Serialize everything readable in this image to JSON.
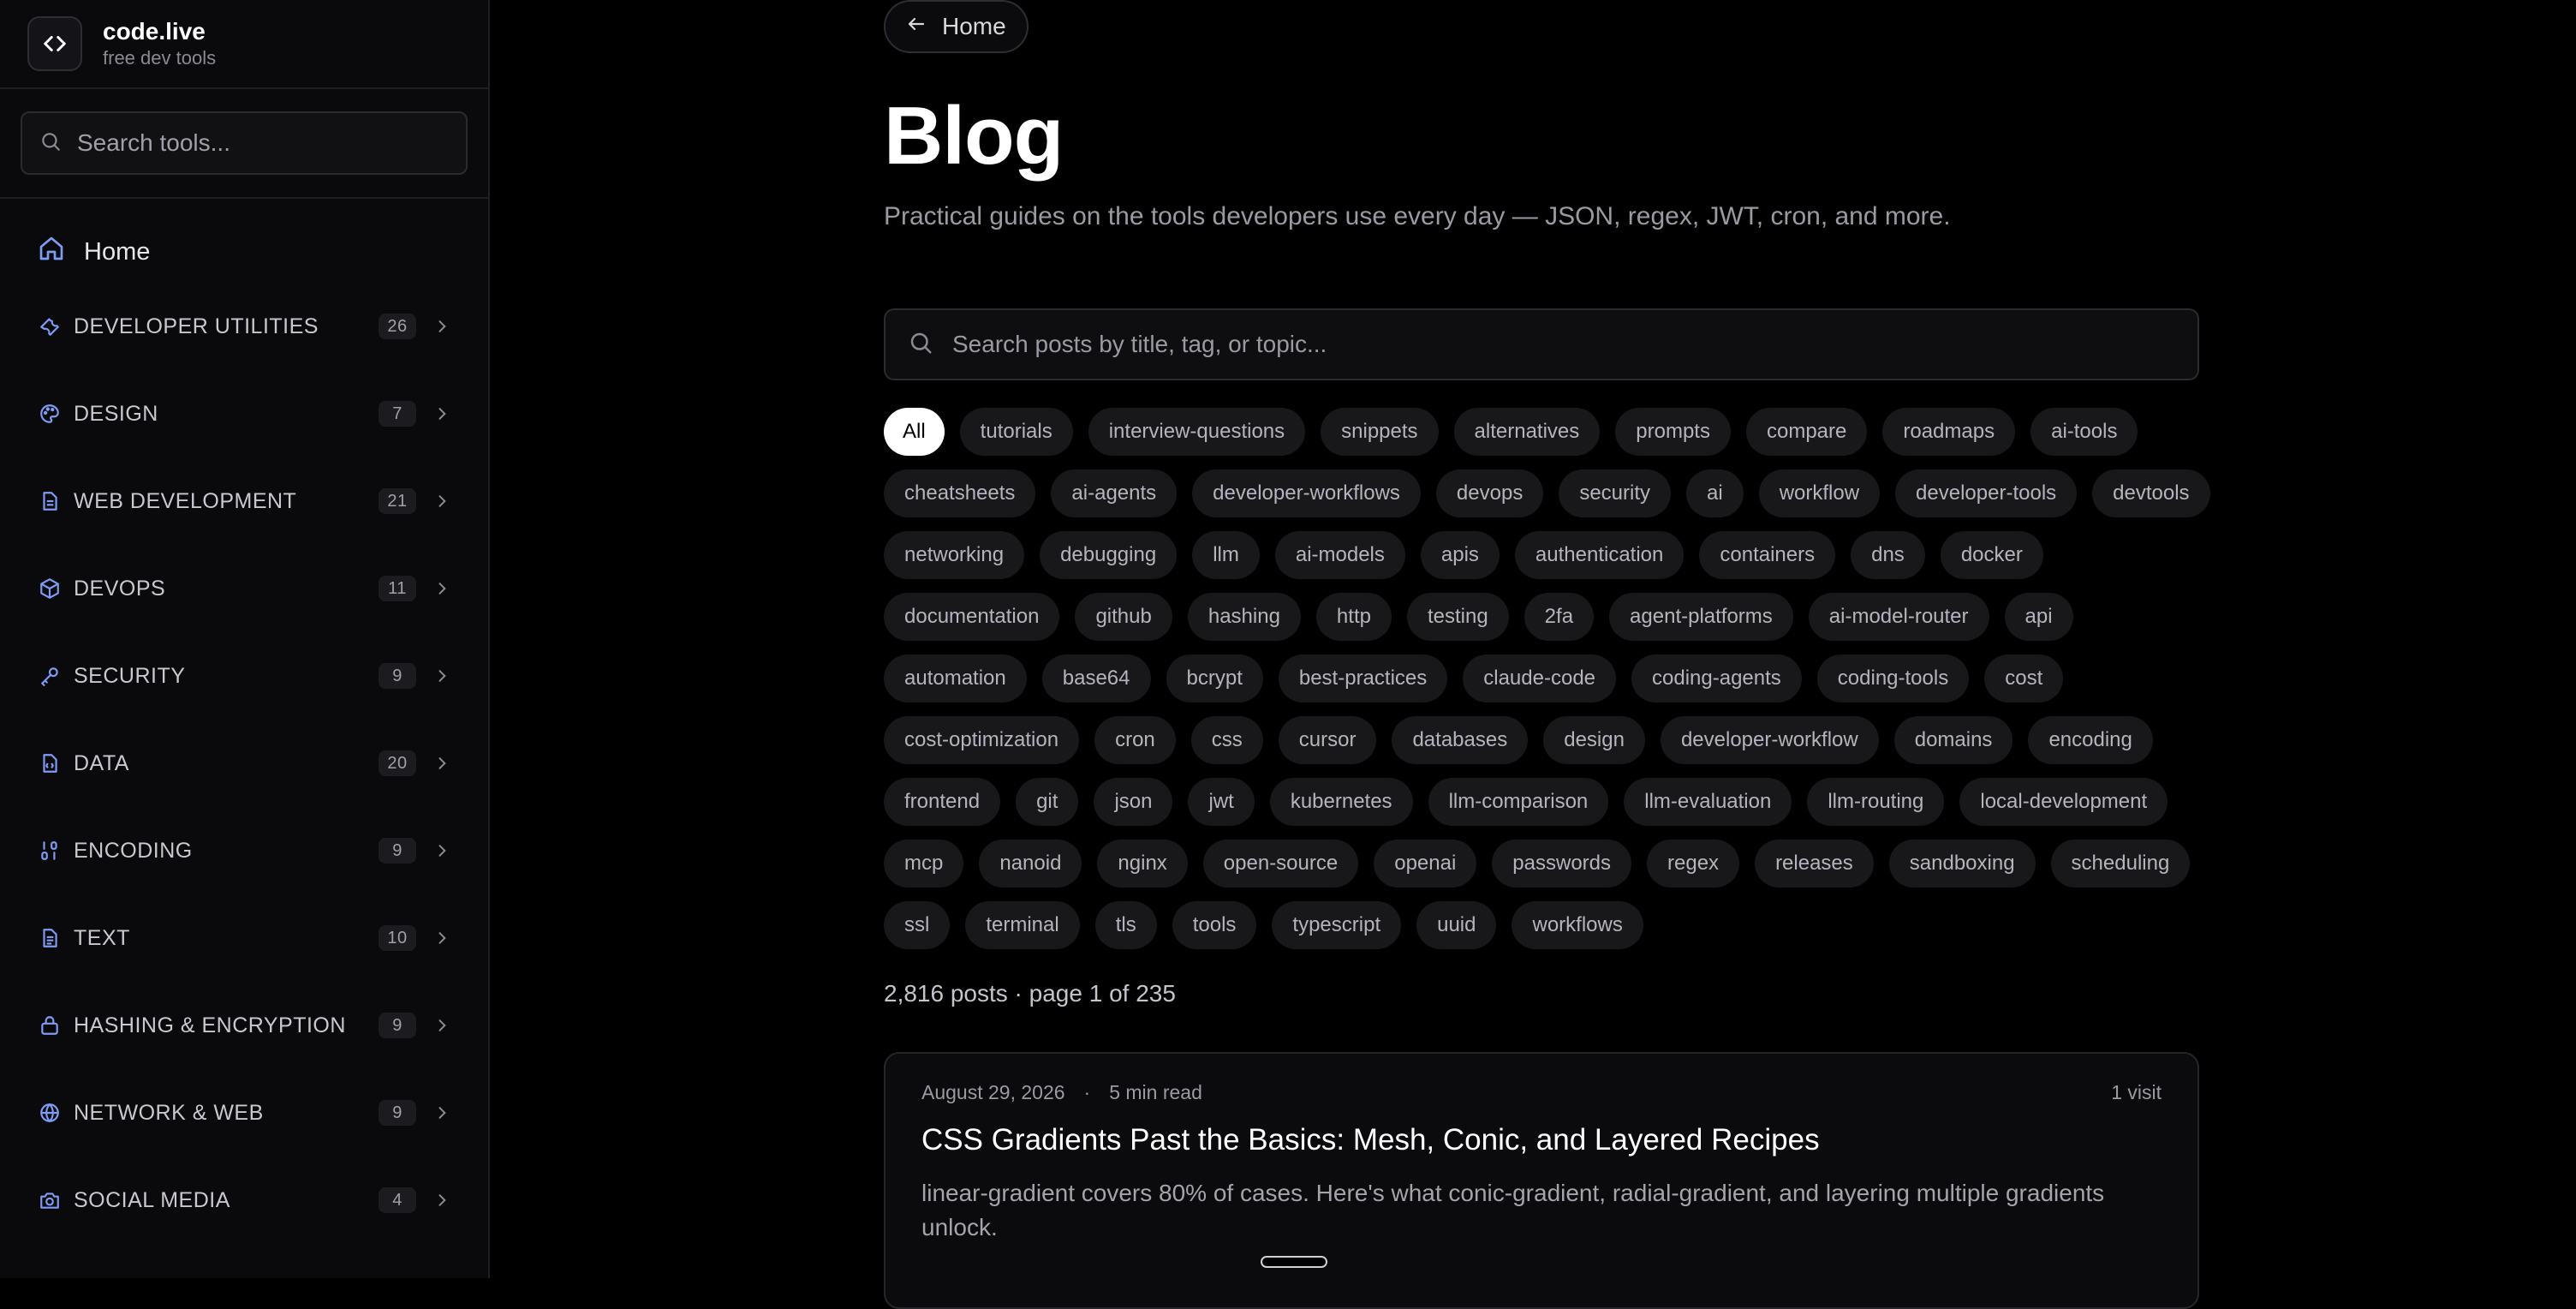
{
  "brand": {
    "name": "code.live",
    "tagline": "free dev tools"
  },
  "sidebar": {
    "search_placeholder": "Search tools...",
    "home_label": "Home",
    "items": [
      {
        "label": "DEVELOPER UTILITIES",
        "count": "26",
        "icon": "wrench-icon"
      },
      {
        "label": "DESIGN",
        "count": "7",
        "icon": "palette-icon"
      },
      {
        "label": "WEB DEVELOPMENT",
        "count": "21",
        "icon": "file-icon"
      },
      {
        "label": "DEVOPS",
        "count": "11",
        "icon": "box-icon"
      },
      {
        "label": "SECURITY",
        "count": "9",
        "icon": "key-icon"
      },
      {
        "label": "DATA",
        "count": "20",
        "icon": "file-code-icon"
      },
      {
        "label": "ENCODING",
        "count": "9",
        "icon": "binary-icon"
      },
      {
        "label": "TEXT",
        "count": "10",
        "icon": "file-text-icon"
      },
      {
        "label": "HASHING & ENCRYPTION",
        "count": "9",
        "icon": "lock-icon"
      },
      {
        "label": "NETWORK & WEB",
        "count": "9",
        "icon": "globe-icon"
      },
      {
        "label": "SOCIAL MEDIA",
        "count": "4",
        "icon": "camera-icon"
      }
    ]
  },
  "main": {
    "home_button": "Home",
    "title": "Blog",
    "subtitle": "Practical guides on the tools developers use every day — JSON, regex, JWT, cron, and more.",
    "search_placeholder": "Search posts by title, tag, or topic...",
    "tags": [
      "All",
      "tutorials",
      "interview-questions",
      "snippets",
      "alternatives",
      "prompts",
      "compare",
      "roadmaps",
      "ai-tools",
      "cheatsheets",
      "ai-agents",
      "developer-workflows",
      "devops",
      "security",
      "ai",
      "workflow",
      "developer-tools",
      "devtools",
      "networking",
      "debugging",
      "llm",
      "ai-models",
      "apis",
      "authentication",
      "containers",
      "dns",
      "docker",
      "documentation",
      "github",
      "hashing",
      "http",
      "testing",
      "2fa",
      "agent-platforms",
      "ai-model-router",
      "api",
      "automation",
      "base64",
      "bcrypt",
      "best-practices",
      "claude-code",
      "coding-agents",
      "coding-tools",
      "cost",
      "cost-optimization",
      "cron",
      "css",
      "cursor",
      "databases",
      "design",
      "developer-workflow",
      "domains",
      "encoding",
      "frontend",
      "git",
      "json",
      "jwt",
      "kubernetes",
      "llm-comparison",
      "llm-evaluation",
      "llm-routing",
      "local-development",
      "mcp",
      "nanoid",
      "nginx",
      "open-source",
      "openai",
      "passwords",
      "regex",
      "releases",
      "sandboxing",
      "scheduling",
      "ssl",
      "terminal",
      "tls",
      "tools",
      "typescript",
      "uuid",
      "workflows"
    ],
    "active_tag": "All",
    "post_count": "2,816 posts · page 1 of 235",
    "post": {
      "date": "August 29, 2026",
      "sep": "·",
      "read_time": "5 min read",
      "visits": "1 visit",
      "title": "CSS Gradients Past the Basics: Mesh, Conic, and Layered Recipes",
      "description": "linear-gradient covers 80% of cases. Here's what conic-gradient, radial-gradient, and layering multiple gradients unlock."
    }
  },
  "colors": {
    "background": "#000000",
    "sidebar": "#0a0a0c",
    "icon_accent": "#7f9cf5",
    "active_tag": "#ffffff"
  }
}
